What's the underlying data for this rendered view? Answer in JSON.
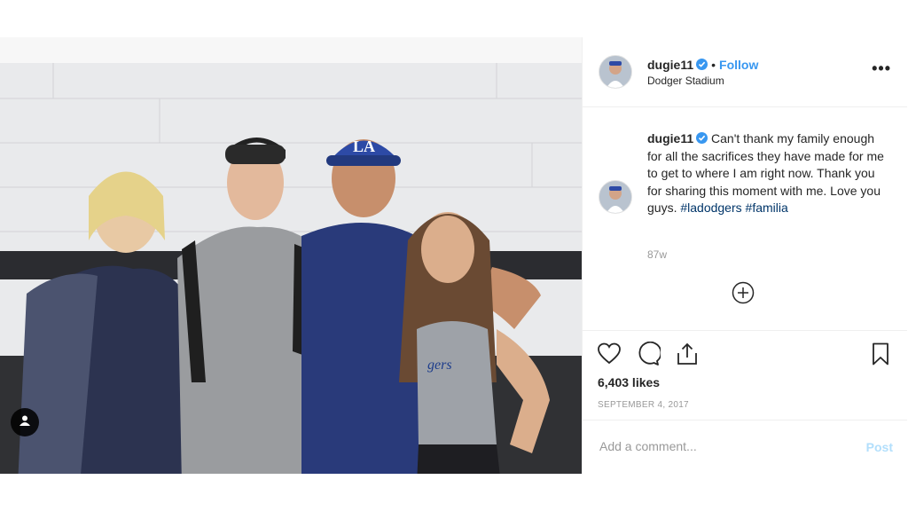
{
  "post": {
    "username": "dugie11",
    "follow_label": "Follow",
    "separator": "•",
    "location": "Dodger Stadium",
    "more_label": "•••",
    "photo_icons": {
      "tag": "user-tag-icon"
    }
  },
  "caption": {
    "username": "dugie11",
    "text": "Can't thank my family enough for all the sacrifices they have made for me to get to where I am right now. Thank you for sharing this moment with me. Love you guys.",
    "hashtags": [
      "#ladodgers",
      "#familia"
    ],
    "age": "87w"
  },
  "actions": {
    "icons": [
      "heart-icon",
      "comment-icon",
      "share-icon",
      "bookmark-icon"
    ],
    "likes": "6,403 likes",
    "date": "SEPTEMBER 4, 2017"
  },
  "comment_box": {
    "placeholder": "Add a comment...",
    "post_label": "Post"
  },
  "colors": {
    "accent": "#3897f0",
    "hashtag": "#003569",
    "muted": "#999999",
    "post_disabled": "#b2dffc"
  }
}
